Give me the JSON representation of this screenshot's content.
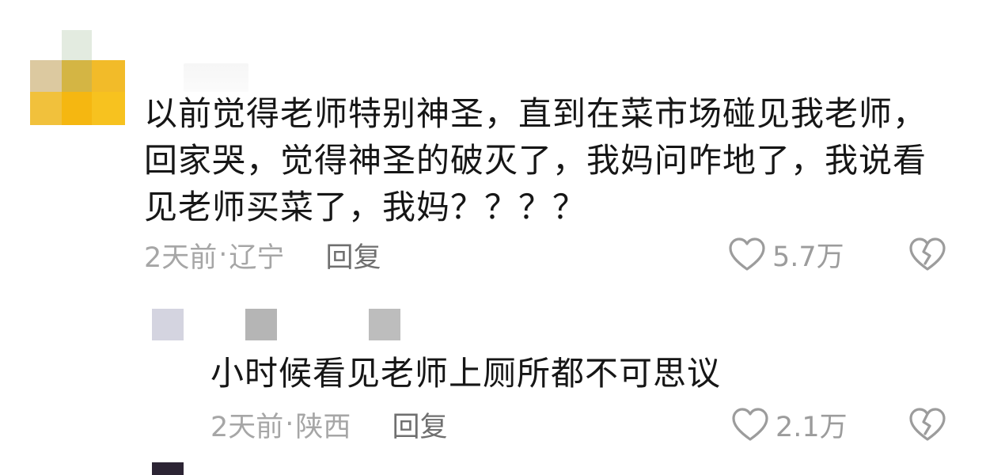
{
  "comments": [
    {
      "text": "以前觉得老师特别神圣，直到在菜市场碰见我老师，回家哭，觉得神圣的破灭了，我妈问咋地了，我说看见老师买菜了，我妈？？？？",
      "time": "2天前",
      "separator": "·",
      "location": "辽宁",
      "reply_label": "回复",
      "likes": "5.7万"
    }
  ],
  "replies": [
    {
      "text": "小时候看见老师上厕所都不可思议",
      "time": "2天前",
      "separator": "·",
      "location": "陕西",
      "reply_label": "回复",
      "likes": "2.1万"
    }
  ],
  "icons": {
    "like": "heart-outline-icon",
    "dislike": "broken-heart-icon"
  },
  "colors": {
    "text": "#161616",
    "meta": "#a6a6a6",
    "reply": "#6f6f6f",
    "icon": "#9c9c9c"
  }
}
